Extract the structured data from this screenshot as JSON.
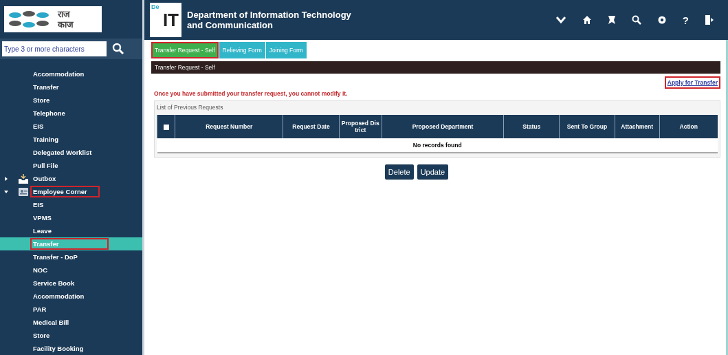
{
  "logo": {
    "line1": "राज",
    "line2": "काज"
  },
  "header": {
    "badge": "De",
    "logo_text": "IT",
    "title_line1": "Department of Information Technology",
    "title_line2": "and Communication",
    "help_glyph": "?"
  },
  "search": {
    "placeholder": "Type 3 or more characters"
  },
  "sidebar": {
    "items": [
      {
        "children": [
          {
            "label": "Accommodation",
            "selected": false,
            "highlighted": false
          },
          {
            "label": "Transfer",
            "selected": false,
            "highlighted": false
          },
          {
            "label": "Store",
            "selected": false,
            "highlighted": false
          },
          {
            "label": "Telephone",
            "selected": false,
            "highlighted": false
          },
          {
            "label": "EIS",
            "selected": false,
            "highlighted": false
          },
          {
            "label": "Training",
            "selected": false,
            "highlighted": false
          },
          {
            "label": "Delegated Worklist",
            "selected": false,
            "highlighted": false
          },
          {
            "label": "Pull File",
            "selected": false,
            "highlighted": false
          }
        ]
      },
      {
        "label": "Outbox",
        "kind": "tray",
        "expanded": false,
        "highlighted": false
      },
      {
        "label": "Employee Corner",
        "kind": "card",
        "expanded": true,
        "highlighted": true,
        "children": [
          {
            "label": "EIS",
            "selected": false,
            "highlighted": false
          },
          {
            "label": "VPMS",
            "selected": false,
            "highlighted": false
          },
          {
            "label": "Leave",
            "selected": false,
            "highlighted": false
          },
          {
            "label": "Transfer",
            "selected": true,
            "highlighted": true
          },
          {
            "label": "Transfer - DoP",
            "selected": false,
            "highlighted": false
          },
          {
            "label": "NOC",
            "selected": false,
            "highlighted": false
          },
          {
            "label": "Service Book",
            "selected": false,
            "highlighted": false
          },
          {
            "label": "Accommodation",
            "selected": false,
            "highlighted": false
          },
          {
            "label": "PAR",
            "selected": false,
            "highlighted": false
          },
          {
            "label": "Medical Bill",
            "selected": false,
            "highlighted": false
          },
          {
            "label": "Store",
            "selected": false,
            "highlighted": false
          },
          {
            "label": "Facility Booking",
            "selected": false,
            "highlighted": false
          }
        ]
      }
    ]
  },
  "tabs": [
    {
      "label": "Transfer Request - Self",
      "selected": true,
      "highlighted": true
    },
    {
      "label": "Relieving Form",
      "selected": false,
      "highlighted": false
    },
    {
      "label": "Joining Form",
      "selected": false,
      "highlighted": false
    }
  ],
  "panel": {
    "title": "Transfer Request - Self",
    "apply_link": {
      "label": "Apply for Transfer",
      "highlighted": true
    },
    "warning": "Once you have submitted your transfer request, you cannot modify it.",
    "list_title": "List of Previous Requests",
    "table": {
      "select_all_checked": false,
      "columns": [
        "Request Number",
        "Request Date",
        "Proposed District",
        "Proposed Department",
        "Status",
        "Sent To Group",
        "Attachment",
        "Action"
      ],
      "empty_message": "No records found"
    },
    "buttons": [
      "Delete",
      "Update"
    ]
  }
}
